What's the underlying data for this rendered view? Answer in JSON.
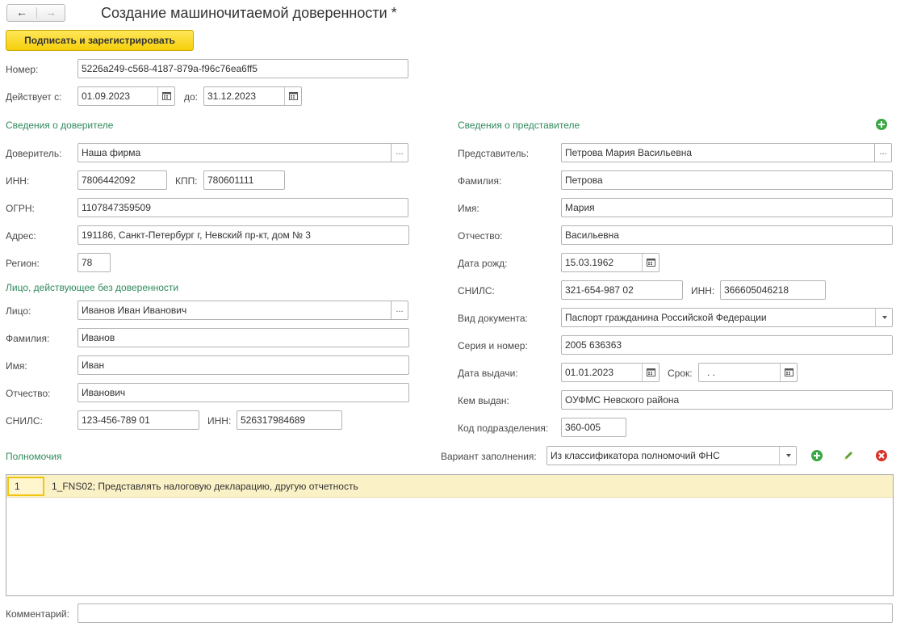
{
  "header": {
    "title": "Создание машиночитаемой доверенности *",
    "back_glyph": "←",
    "forward_glyph": "→",
    "primary_button": "Подписать и зарегистрировать"
  },
  "general": {
    "number_label": "Номер:",
    "number_value": "5226a249-c568-4187-879a-f96c76ea6ff5",
    "valid_from_label": "Действует с:",
    "valid_from_value": "01.09.2023",
    "valid_to_label": "до:",
    "valid_to_value": "31.12.2023"
  },
  "principal": {
    "section_title": "Сведения о доверителе",
    "principal_label": "Доверитель:",
    "principal_value": "Наша фирма",
    "inn_label": "ИНН:",
    "inn_value": "7806442092",
    "kpp_label": "КПП:",
    "kpp_value": "780601111",
    "ogrn_label": "ОГРН:",
    "ogrn_value": "1107847359509",
    "address_label": "Адрес:",
    "address_value": "191186, Санкт-Петербург г, Невский пр-кт, дом № 3",
    "region_label": "Регион:",
    "region_value": "78"
  },
  "person": {
    "section_title": "Лицо, действующее без доверенности",
    "person_label": "Лицо:",
    "person_value": "Иванов Иван Иванович",
    "surname_label": "Фамилия:",
    "surname_value": "Иванов",
    "name_label": "Имя:",
    "name_value": "Иван",
    "patronymic_label": "Отчество:",
    "patronymic_value": "Иванович",
    "snils_label": "СНИЛС:",
    "snils_value": "123-456-789 01",
    "inn_label": "ИНН:",
    "inn_value": "526317984689"
  },
  "representative": {
    "section_title": "Сведения о представителе",
    "rep_label": "Представитель:",
    "rep_value": "Петрова Мария Васильевна",
    "surname_label": "Фамилия:",
    "surname_value": "Петрова",
    "name_label": "Имя:",
    "name_value": "Мария",
    "patronymic_label": "Отчество:",
    "patronymic_value": "Васильевна",
    "birth_label": "Дата рожд:",
    "birth_value": "15.03.1962",
    "snils_label": "СНИЛС:",
    "snils_value": "321-654-987 02",
    "inn_label": "ИНН:",
    "inn_value": "366605046218",
    "doc_type_label": "Вид документа:",
    "doc_type_value": "Паспорт гражданина Российской Федерации",
    "series_label": "Серия и номер:",
    "series_value": "2005 636363",
    "issue_date_label": "Дата выдачи:",
    "issue_date_value": "01.01.2023",
    "term_label": "Срок:",
    "term_value": " .  .",
    "issued_by_label": "Кем выдан:",
    "issued_by_value": "ОУФМС Невского района",
    "dept_code_label": "Код подразделения:",
    "dept_code_value": "360-005"
  },
  "powers": {
    "section_title": "Полномочия",
    "fill_variant_label": "Вариант заполнения:",
    "fill_variant_value": "Из классификатора полномочий ФНС",
    "rows": [
      {
        "num": "1",
        "text": "1_FNS02; Представлять налоговую декларацию, другую отчетность"
      }
    ]
  },
  "comment": {
    "label": "Комментарий:",
    "value": ""
  },
  "colors": {
    "accent_green": "#2f8a5a",
    "primary_yellow": "#f5cf0a",
    "add_green": "#3aa844",
    "delete_red": "#d9342b"
  }
}
